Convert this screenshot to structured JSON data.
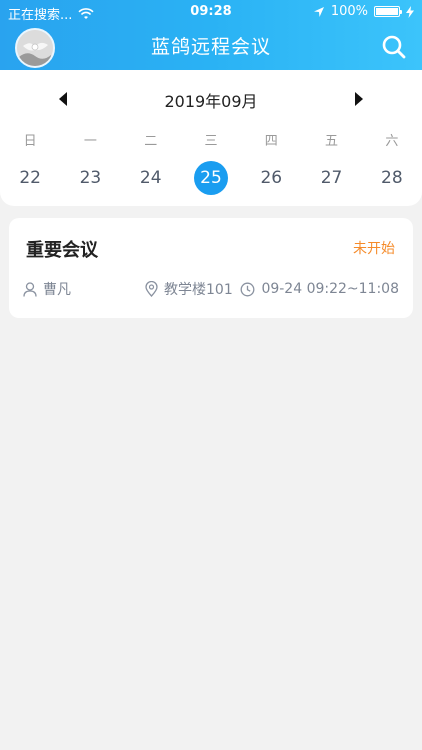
{
  "status_bar": {
    "carrier": "正在搜索...",
    "time": "09:28",
    "battery": "100%",
    "battery_level": 1.0
  },
  "header": {
    "title": "蓝鸽远程会议",
    "avatar_icon": "avatar",
    "search_icon": "search-icon"
  },
  "calendar": {
    "month": "2019年09月",
    "prev_icon": "caret-left-icon",
    "next_icon": "caret-right-icon",
    "weekdays": [
      "日",
      "一",
      "二",
      "三",
      "四",
      "五",
      "六"
    ],
    "dates": [
      "22",
      "23",
      "24",
      "25",
      "26",
      "27",
      "28"
    ],
    "selected_date": "25",
    "accent_color": "#1a9df0"
  },
  "meetings": [
    {
      "title": "重要会议",
      "status": "未开始",
      "status_color": "#f58b2a",
      "host": "曹凡",
      "location": "教学楼101",
      "time": "09-24 09:22~11:08"
    }
  ]
}
